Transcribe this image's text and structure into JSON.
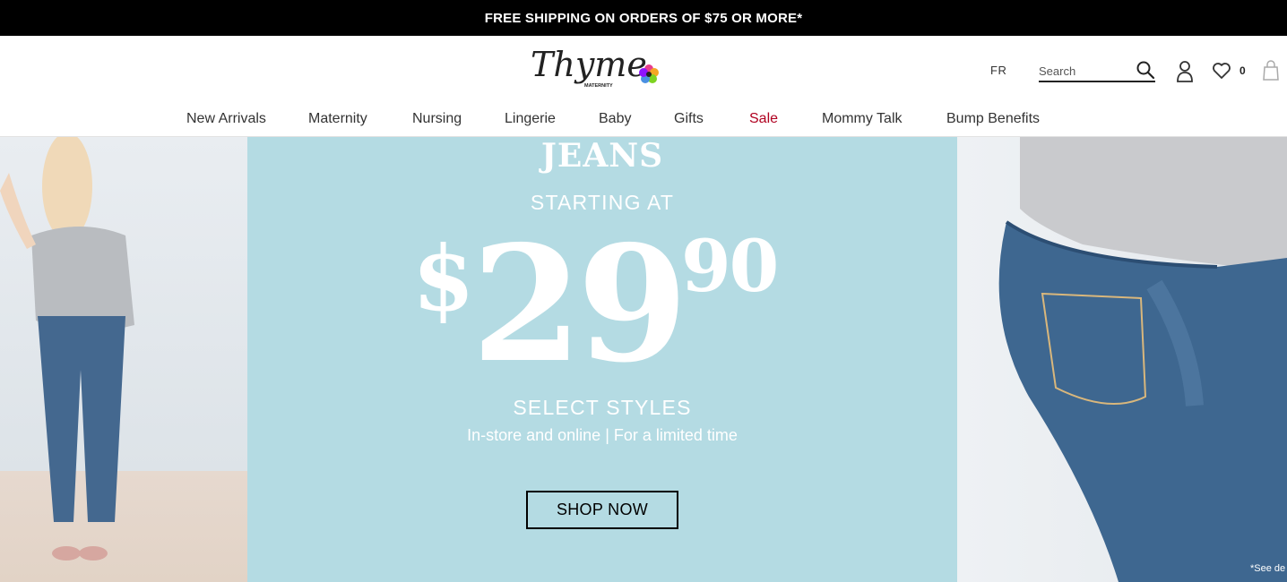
{
  "promo_bar": {
    "text": "FREE SHIPPING ON ORDERS OF $75 OR MORE*"
  },
  "header": {
    "logo": {
      "wordmark": "Thyme",
      "tagline": "MATERNITY",
      "icon": "flower-icon"
    },
    "language": "FR",
    "search": {
      "placeholder": "Search",
      "icon": "search-icon"
    },
    "account_icon": "user-icon",
    "wishlist": {
      "icon": "heart-icon",
      "count": "0"
    },
    "bag_icon": "shopping-bag-icon"
  },
  "nav": {
    "items": [
      {
        "label": "New Arrivals"
      },
      {
        "label": "Maternity"
      },
      {
        "label": "Nursing"
      },
      {
        "label": "Lingerie"
      },
      {
        "label": "Baby"
      },
      {
        "label": "Gifts"
      },
      {
        "label": "Sale"
      },
      {
        "label": "Mommy Talk"
      },
      {
        "label": "Bump Benefits"
      }
    ]
  },
  "hero": {
    "headline": "JEANS",
    "starting_at": "STARTING AT",
    "price": {
      "currency": "$",
      "dollars": "29",
      "cents": "90"
    },
    "select_styles": "SELECT STYLES",
    "subtext": "In-store and online | For a limited time",
    "cta": "SHOP NOW",
    "disclaimer": "*See de"
  },
  "colors": {
    "promo_bar_bg": "#000000",
    "panel_bg": "#b4dbe3",
    "sale": "#b00020"
  }
}
